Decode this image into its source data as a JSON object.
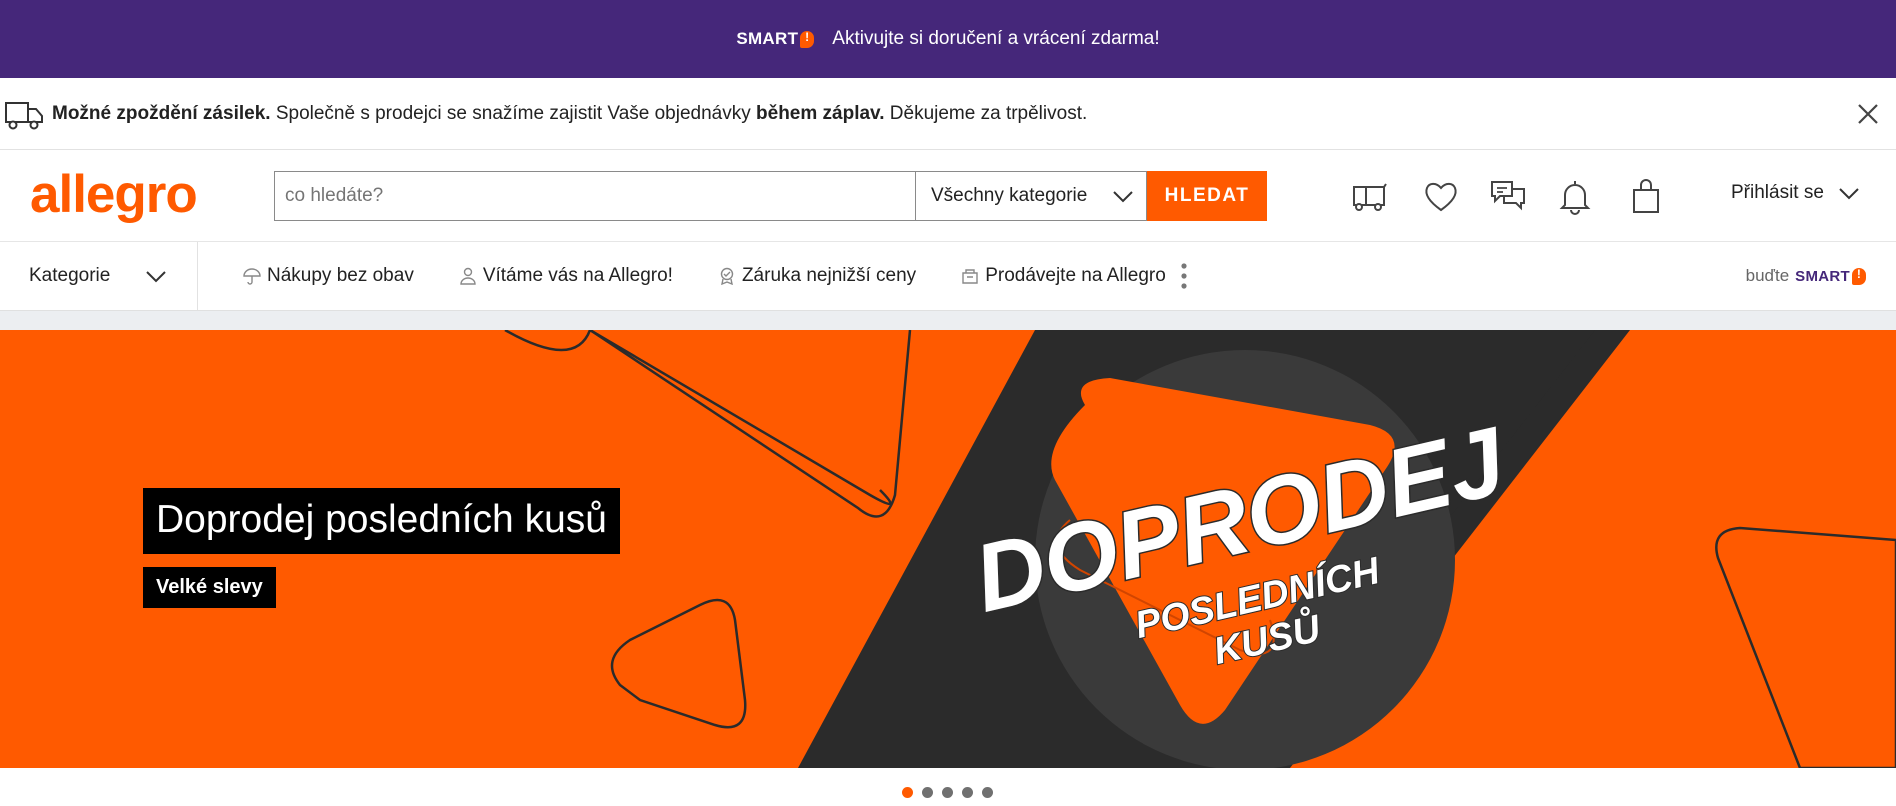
{
  "promo": {
    "smart_logo": "SMART",
    "text": "Aktivujte si doručení a vrácení zdarma!"
  },
  "notice": {
    "bold1": "Možné zpoždění zásilek.",
    "text1": " Společně s prodejci se snažíme zajistit Vaše objednávky ",
    "bold2": "během záplav.",
    "text2": " Děkujeme za trpělivost."
  },
  "header": {
    "logo": "allegro",
    "search_placeholder": "co hledáte?",
    "category_select": "Všechny kategorie",
    "search_button": "HLEDAT",
    "icons": [
      "delivery-truck-icon",
      "heart-icon",
      "chat-icon",
      "bell-icon",
      "shopping-bag-icon"
    ],
    "login": "Přihlásit se"
  },
  "nav": {
    "categories": "Kategorie",
    "items": [
      {
        "icon": "umbrella-icon",
        "label": "Nákupy bez obav"
      },
      {
        "icon": "user-icon",
        "label": "Vítáme vás na Allegro!"
      },
      {
        "icon": "badge-icon",
        "label": "Záruka nejnižší ceny"
      },
      {
        "icon": "shop-icon",
        "label": "Prodávejte na Allegro"
      }
    ],
    "smart_prefix": "buďte",
    "smart_logo": "SMART"
  },
  "banner": {
    "title": "Doprodej posledních kusů",
    "subtitle": "Velké slevy",
    "graphic_line1": "DOPRODEJ",
    "graphic_line2": "POSLEDNÍCH",
    "graphic_line3": "KUSŮ"
  },
  "carousel": {
    "count": 5,
    "active": 1
  },
  "colors": {
    "brand_orange": "#ff5a00",
    "smart_purple": "#45277a",
    "banner_dark": "#2b2b2b"
  }
}
